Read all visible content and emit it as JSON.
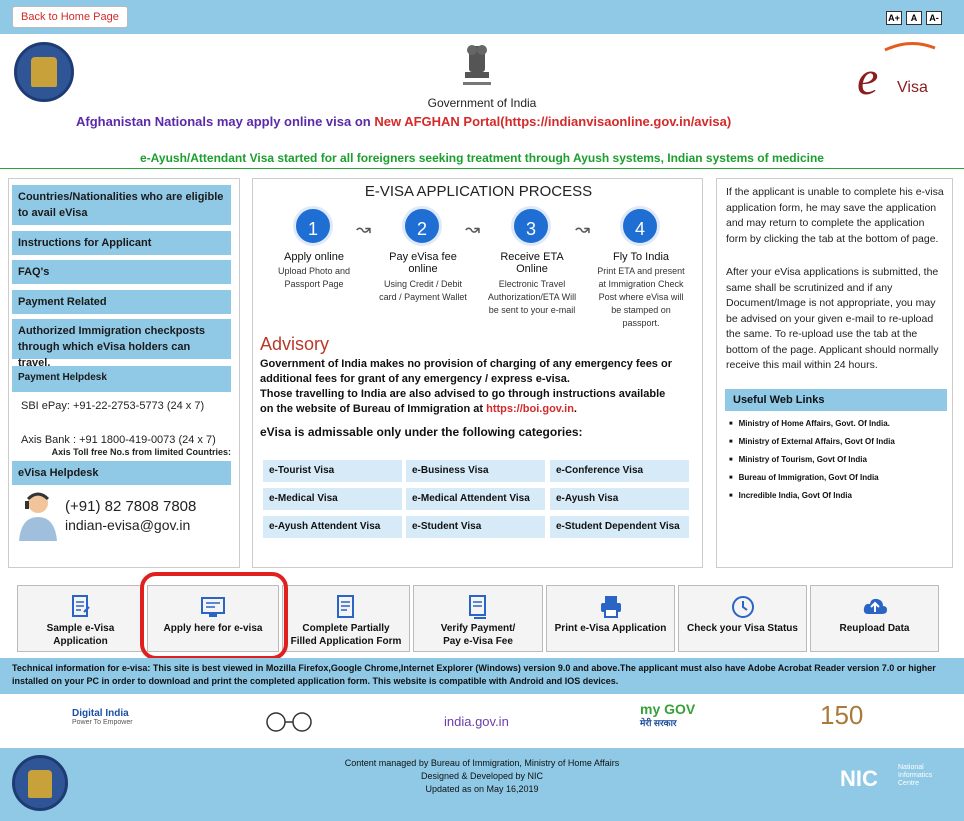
{
  "topbar": {
    "back_label": "Back to Home Page",
    "font_buttons": [
      "A+",
      "A",
      "A-"
    ]
  },
  "header": {
    "emblem_caption": "Government of India",
    "afghan_notice_prefix": "Afghanistan Nationals may apply online visa on ",
    "afghan_notice_portal": "New AFGHAN Portal(https://indianvisaonline.gov.in/avisa)",
    "ayush_notice": "e-Ayush/Attendant Visa started for all foreigners seeking treatment through Ayush systems, Indian systems of medicine",
    "logo_right": "e-Visa"
  },
  "sidebar": {
    "items": [
      "Countries/Nationalities who are eligible to avail eVisa",
      "Instructions for Applicant",
      "FAQ's",
      "Payment Related",
      "Authorized Immigration checkposts through which eVisa holders can travel.",
      "Payment Helpdesk"
    ],
    "sbi": "SBI ePay: +91-22-2753-5773 (24 x 7)",
    "axis": "Axis Bank : +91 1800-419-0073 (24 x 7)",
    "toll": "Axis Toll free No.s from limited Countries:",
    "helpdesk_label": "eVisa Helpdesk",
    "phone": "(+91) 82 7808 7808",
    "email": "indian-evisa@gov.in"
  },
  "process": {
    "title": "E-VISA APPLICATION PROCESS",
    "steps": [
      {
        "num": "1",
        "title": "Apply online",
        "desc": "Upload Photo and Passport Page"
      },
      {
        "num": "2",
        "title": "Pay eVisa fee online",
        "desc": "Using Credit / Debit card / Payment Wallet"
      },
      {
        "num": "3",
        "title": "Receive ETA Online",
        "desc": "Electronic Travel Authorization/ETA Will be sent to your e-mail"
      },
      {
        "num": "4",
        "title": "Fly To India",
        "desc": "Print ETA and present at Immigration Check Post where eVisa will be stamped on passport."
      }
    ],
    "advisory_title": "Advisory",
    "advisory_line1": "Government of India makes no provision of charging of any emergency fees or additional fees for grant of any emergency / express e-visa.",
    "advisory_line2": "Those travelling to India are also advised to go through instructions available on the website of Bureau of Immigration at ",
    "advisory_link": "https://boi.gov.in",
    "advisory_end": ".",
    "categories_title": "eVisa is admissable only under the following categories:",
    "categories": [
      "e-Tourist Visa",
      "e-Business Visa",
      "e-Conference Visa",
      "e-Medical Visa",
      "e-Medical Attendent Visa",
      "e-Ayush Visa",
      "e-Ayush Attendent Visa",
      "e-Student Visa",
      "e-Student Dependent Visa"
    ]
  },
  "right": {
    "para1": "If the applicant is unable to complete his e-visa application form, he may save the application and may return to complete the application form by clicking the tab at the bottom of page.",
    "para2": "After your eVisa applications is submitted, the same shall be scrutinized and if any Document/Image is not appropriate, you may be advised on your given e-mail to re-upload the same. To re-upload use the tab at the bottom of the page. Applicant should normally receive this mail within 24 hours.",
    "useful_title": "Useful Web Links",
    "links": [
      "Ministry of Home Affairs, Govt. Of India.",
      "Ministry of External Affairs, Govt Of India",
      "Ministry of Tourism, Govt Of India",
      "Bureau of Immigration, Govt Of India",
      "Incredible India, Govt Of India"
    ]
  },
  "tiles": [
    {
      "label1": "Sample e-Visa",
      "label2": "Application",
      "icon": "document-icon"
    },
    {
      "label1": "Apply here for e-visa",
      "label2": "",
      "icon": "apply-icon"
    },
    {
      "label1": "Complete Partially",
      "label2": "Filled Application Form",
      "icon": "form-icon"
    },
    {
      "label1": "Verify Payment/",
      "label2": "Pay e-Visa Fee",
      "icon": "verify-icon"
    },
    {
      "label1": "Print e-Visa Application",
      "label2": "",
      "icon": "printer-icon"
    },
    {
      "label1": "Check your Visa Status",
      "label2": "",
      "icon": "status-icon"
    },
    {
      "label1": "Reupload Data",
      "label2": "",
      "icon": "upload-icon"
    }
  ],
  "tech": {
    "lead": "Technical information for e-visa:",
    "body": " This site is best viewed in Mozilla Firefox,Google Chrome,Internet Explorer (Windows) version 9.0 and above.The applicant must also have Adobe Acrobat Reader version 7.0 or higher installed on your PC in order to download and print the completed application form. This website is compatible with Android and IOS devices."
  },
  "logos": {
    "digital_india": "Digital India",
    "digital_india_sub": "Power To Empower",
    "india_gov": "india.gov.in",
    "mygov": "my GOV",
    "mygov_hindi": "मेरी सरकार",
    "gandhi": "150"
  },
  "footer": {
    "line1": "Content managed by Bureau of Immigration, Ministry of Home Affairs",
    "line2": "Designed & Developed by NIC",
    "line3": "Updated as on May 16,2019",
    "nic": "NIC",
    "nic_sub1": "National",
    "nic_sub2": "Informatics",
    "nic_sub3": "Centre"
  }
}
